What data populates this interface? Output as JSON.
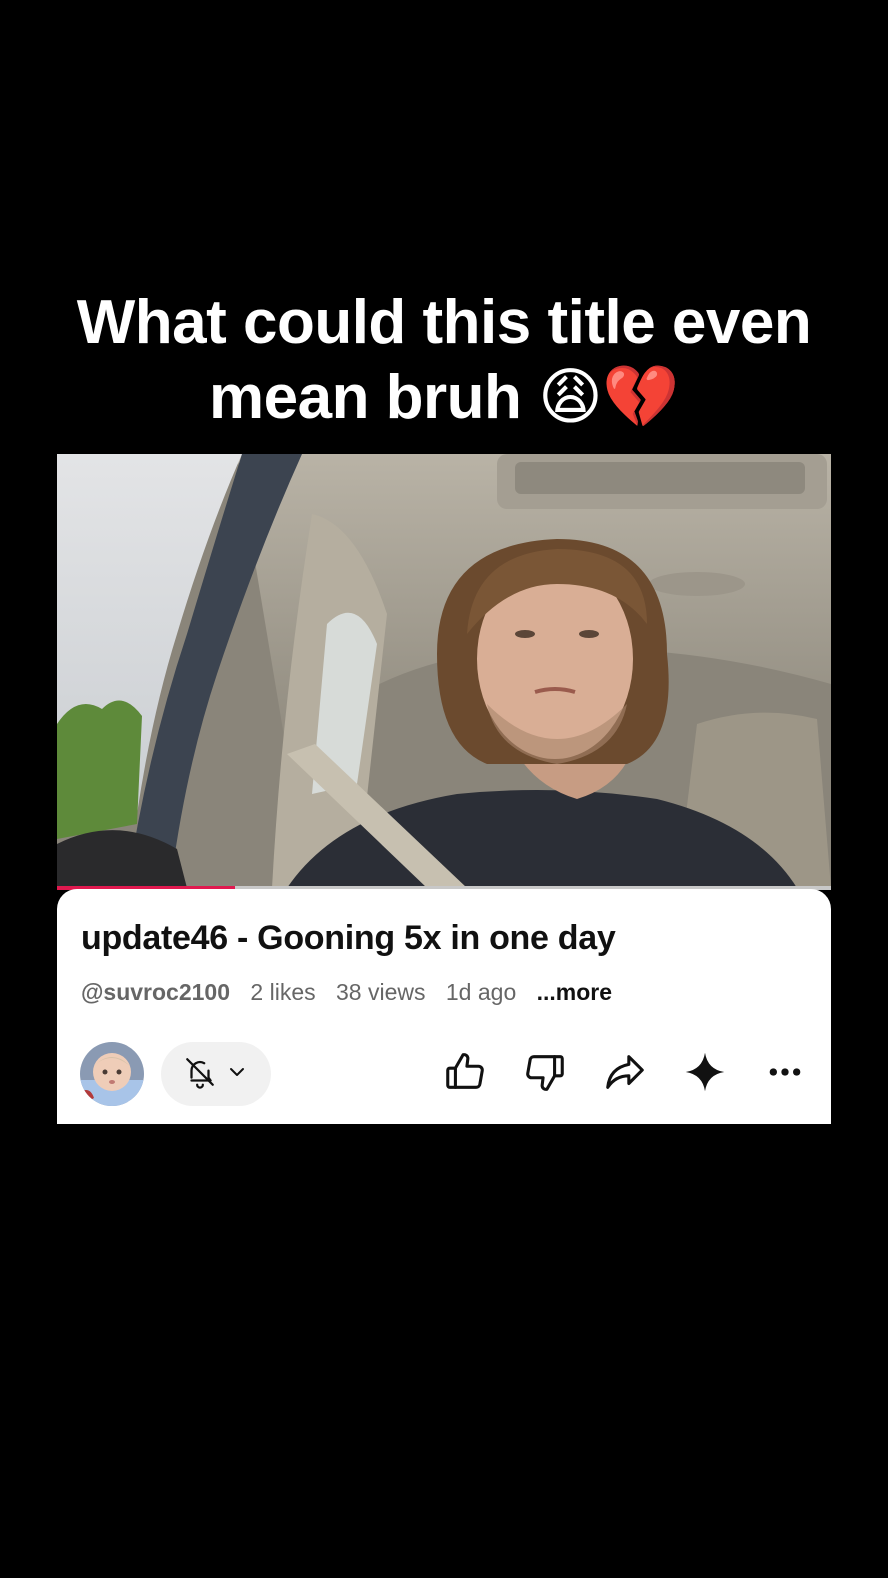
{
  "overlay_caption": {
    "line1": "What could this title even",
    "line2": "mean bruh",
    "emojis": "😩💔"
  },
  "video": {
    "progress": 0.23,
    "progress_color": "#e0194f"
  },
  "details": {
    "title": "update46 - Gooning 5x in one day",
    "handle": "@suvroc2100",
    "likes": "2 likes",
    "views": "38 views",
    "age": "1d ago",
    "more": "...more"
  },
  "actions": {
    "subscribe_icon": "bell-off-icon",
    "icons": [
      "thumbs-up-icon",
      "thumbs-down-icon",
      "share-icon",
      "sparkle-icon",
      "more-icon"
    ]
  }
}
